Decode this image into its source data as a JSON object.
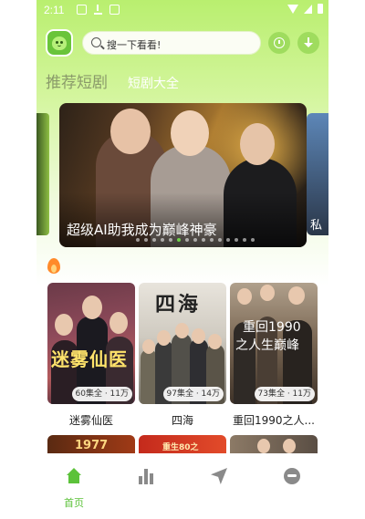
{
  "status_bar": {
    "time": "2:11"
  },
  "header": {
    "search_placeholder": "搜一下看看!"
  },
  "tabs": [
    {
      "label": "推荐短剧",
      "active": true
    },
    {
      "label": "短剧大全",
      "active": false
    }
  ],
  "banner": {
    "title": "超级AI助我成为巅峰神豪",
    "next_peek_text": "私",
    "dots": 15,
    "active_dot": 5
  },
  "dramas": [
    {
      "name": "迷雾仙医",
      "poster_text": "迷雾仙医",
      "badge": "60集全 · 11万"
    },
    {
      "name": "四海",
      "poster_text": "四海",
      "badge": "97集全 · 14万"
    },
    {
      "name": "重回1990之人...",
      "poster_text_1": "重回1990",
      "poster_text_2": "之人生巅峰",
      "badge": "73集全 · 11万"
    }
  ],
  "second_row_peek": [
    "1977",
    "重生80之",
    ""
  ],
  "bottom_nav": [
    {
      "label": "首页",
      "icon": "home-icon",
      "active": true
    },
    {
      "label": "",
      "icon": "ranking-icon",
      "active": false
    },
    {
      "label": "",
      "icon": "send-icon",
      "active": false
    },
    {
      "label": "",
      "icon": "profile-icon",
      "active": false
    }
  ],
  "colors": {
    "accent": "#5cc23a",
    "header_gradient": "#b9ef6f",
    "flame": "#ff8a2a"
  }
}
